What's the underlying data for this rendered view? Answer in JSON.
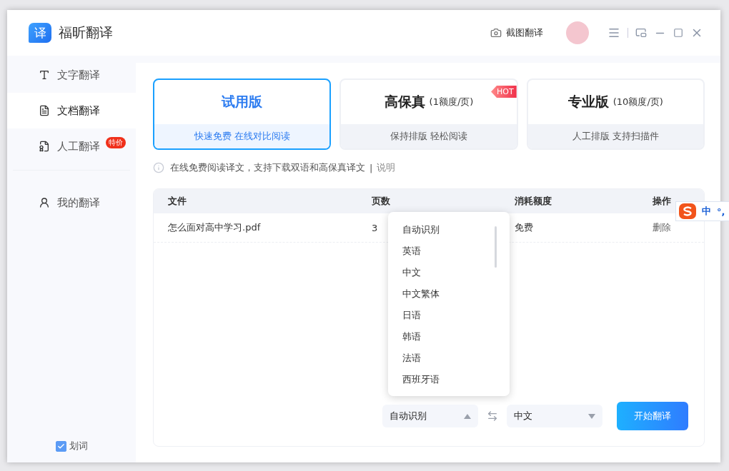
{
  "app": {
    "logo_glyph": "译",
    "title": "福昕翻译"
  },
  "header": {
    "screenshot_button": "截图翻译"
  },
  "sidebar": {
    "items": [
      {
        "kind": "text",
        "label": "文字翻译",
        "selected": false
      },
      {
        "kind": "document",
        "label": "文档翻译",
        "selected": true
      },
      {
        "kind": "human",
        "label": "人工翻译",
        "selected": false,
        "badge": "特价"
      },
      {
        "kind": "mine",
        "label": "我的翻译",
        "selected": false
      }
    ],
    "word_pick": {
      "label": "划词",
      "checked": true
    }
  },
  "plans": [
    {
      "name": "试用版",
      "subtitle": "快速免费 在线对比阅读",
      "selected": true
    },
    {
      "name": "高保真",
      "price": "(1额度/页)",
      "subtitle": "保持排版 轻松阅读",
      "selected": false,
      "badge": "HOT"
    },
    {
      "name": "专业版",
      "price": "(10额度/页)",
      "subtitle": "人工排版 支持扫描件",
      "selected": false
    }
  ],
  "notice": {
    "text": "在线免费阅读译文，支持下载双语和高保真译文",
    "separator": "|",
    "link": "说明"
  },
  "table": {
    "columns": [
      "文件",
      "页数",
      "消耗额度",
      "操作"
    ],
    "rows": [
      {
        "file": "怎么面对高中学习.pdf",
        "pages": "3",
        "cost": "免费",
        "action": "删除"
      }
    ]
  },
  "source_select": {
    "value": "自动识别",
    "expanded": true
  },
  "target_select": {
    "value": "中文",
    "expanded": false
  },
  "language_options": [
    "自动识别",
    "英语",
    "中文",
    "中文繁体",
    "日语",
    "韩语",
    "法语",
    "西班牙语"
  ],
  "start_button": "开始翻译",
  "ime": {
    "mode": "中",
    "punctuation": "°,"
  }
}
